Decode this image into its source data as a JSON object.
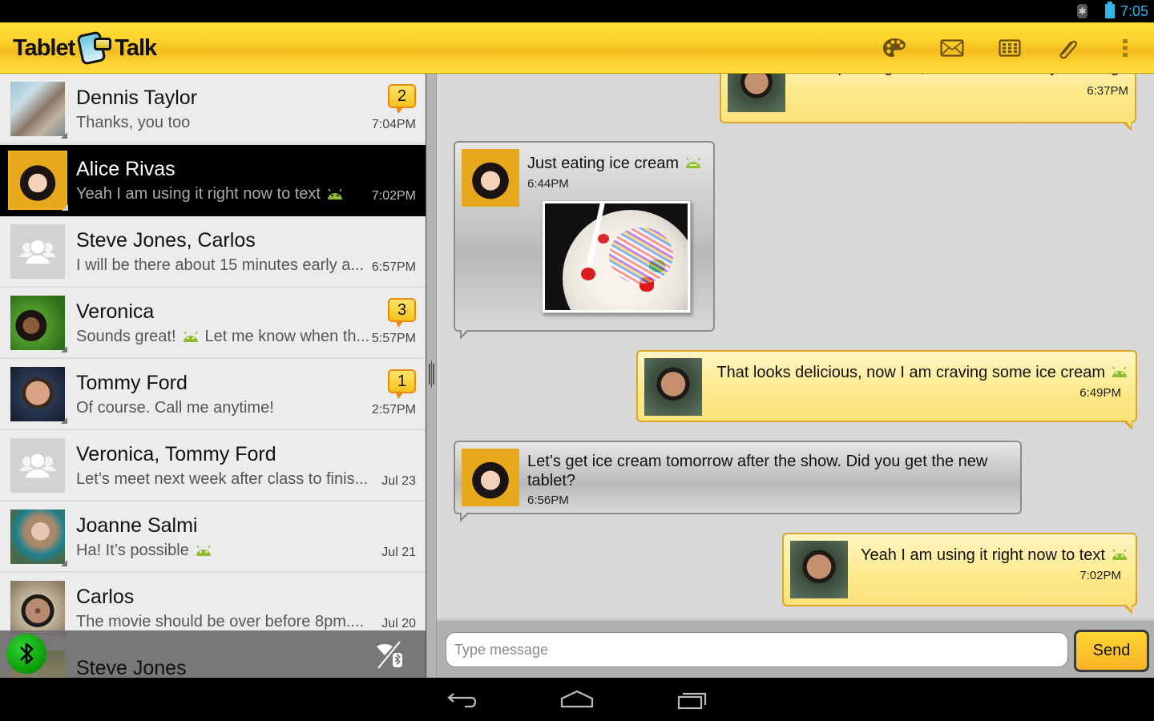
{
  "status_bar": {
    "clock": "7:05",
    "icons": [
      "bluetooth-icon",
      "battery-icon"
    ]
  },
  "action_bar": {
    "app_name_left": "Tablet",
    "app_name_right": "Talk",
    "actions": [
      {
        "name": "theme-palette",
        "icon": "palette-icon"
      },
      {
        "name": "compose-message",
        "icon": "envelope-icon"
      },
      {
        "name": "grid-view",
        "icon": "grid-icon"
      },
      {
        "name": "attach",
        "icon": "paperclip-icon"
      },
      {
        "name": "overflow-menu",
        "icon": "more-vert-icon"
      }
    ]
  },
  "conversations": [
    {
      "name": "Dennis Taylor",
      "preview": "Thanks, you too",
      "time": "7:04PM",
      "unread": "2",
      "avatar": "photo",
      "selected": false
    },
    {
      "name": "Alice Rivas",
      "preview": "Yeah I am using it right now to text",
      "time": "7:02PM",
      "unread": null,
      "avatar": "photo",
      "selected": true,
      "emoji": "android-icon"
    },
    {
      "name": "Steve Jones, Carlos",
      "preview": "I will be there about 15 minutes early a...",
      "time": "6:57PM",
      "unread": null,
      "avatar": "group"
    },
    {
      "name": "Veronica",
      "preview_before": "Sounds great!",
      "preview_after": "Let me know when th...",
      "time": "5:57PM",
      "unread": "3",
      "avatar": "photo",
      "emoji": "android-icon"
    },
    {
      "name": "Tommy Ford",
      "preview": "Of course. Call me anytime!",
      "time": "2:57PM",
      "unread": "1",
      "avatar": "photo"
    },
    {
      "name": "Veronica, Tommy Ford",
      "preview": "Let’s meet next week after class to finis...",
      "time": "Jul 23",
      "unread": null,
      "avatar": "group"
    },
    {
      "name": "Joanne Salmi",
      "preview": "Ha! It’s possible",
      "time": "Jul 21",
      "unread": null,
      "avatar": "photo",
      "emoji": "android-icon"
    },
    {
      "name": "Carlos",
      "preview": "The movie should be over before 8pm....",
      "time": "Jul 20",
      "unread": null,
      "avatar": "photo"
    },
    {
      "name": "Steve Jones",
      "preview": "",
      "time": "",
      "unread": null,
      "avatar": "photo"
    }
  ],
  "messages": [
    {
      "direction": "out",
      "text": "The trip was great, thanks. How are you doing?",
      "time": "6:37PM"
    },
    {
      "direction": "in",
      "text": "Just eating ice cream",
      "time": "6:44PM",
      "emoji": "android-icon",
      "attachment": "ice-cream-photo"
    },
    {
      "direction": "out",
      "text": "That looks delicious, now I am craving some ice cream",
      "time": "6:49PM",
      "emoji": "android-icon"
    },
    {
      "direction": "in",
      "text": "Let’s get ice cream tomorrow after the show. Did you get the new tablet?",
      "time": "6:56PM"
    },
    {
      "direction": "out",
      "text": "Yeah I am using it right now to text",
      "time": "7:02PM",
      "emoji": "android-icon"
    }
  ],
  "composer": {
    "placeholder": "Type message",
    "value": "",
    "send_label": "Send"
  },
  "colors": {
    "accent_yellow": "#fbd02a",
    "badge_border": "#e98a10",
    "status_blue": "#33b5e5",
    "android_green": "#8bbf2c",
    "bluetooth_green": "#0a9a0a"
  },
  "nav_bar": {
    "buttons": [
      "back",
      "home",
      "recent-apps"
    ]
  }
}
